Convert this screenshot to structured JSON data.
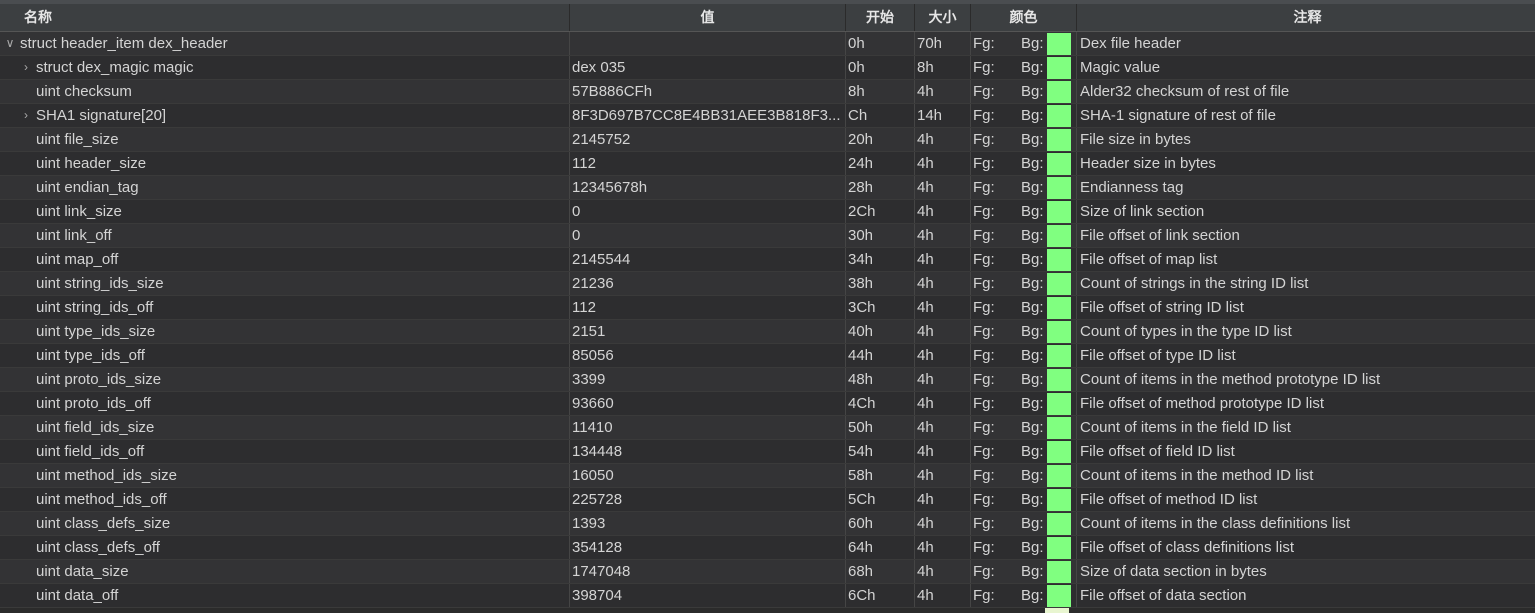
{
  "columns": {
    "name": "名称",
    "value": "值",
    "start": "开始",
    "size": "大小",
    "color": "颜色",
    "comment": "注释"
  },
  "color_labels": {
    "fg": "Fg:",
    "bg": "Bg:"
  },
  "colors": {
    "bg_swatch": "#80ff80",
    "header_bg": "#3c3f41",
    "row_bg": "#2d2d2f"
  },
  "rows": [
    {
      "name": "struct header_item dex_header",
      "value": "",
      "start": "0h",
      "size": "70h",
      "comment": "Dex file header",
      "level": 0,
      "expander": "expanded"
    },
    {
      "name": "struct dex_magic magic",
      "value": "dex 035",
      "start": "0h",
      "size": "8h",
      "comment": "Magic value",
      "level": 1,
      "expander": "collapsed"
    },
    {
      "name": "uint checksum",
      "value": "57B886CFh",
      "start": "8h",
      "size": "4h",
      "comment": "Alder32 checksum of rest of file",
      "level": 1,
      "expander": "none"
    },
    {
      "name": "SHA1 signature[20]",
      "value": "8F3D697B7CC8E4BB31AEE3B818F3...",
      "start": "Ch",
      "size": "14h",
      "comment": "SHA-1 signature of rest of file",
      "level": 1,
      "expander": "collapsed"
    },
    {
      "name": "uint file_size",
      "value": "2145752",
      "start": "20h",
      "size": "4h",
      "comment": "File size in bytes",
      "level": 1,
      "expander": "none"
    },
    {
      "name": "uint header_size",
      "value": "112",
      "start": "24h",
      "size": "4h",
      "comment": "Header size in bytes",
      "level": 1,
      "expander": "none"
    },
    {
      "name": "uint endian_tag",
      "value": "12345678h",
      "start": "28h",
      "size": "4h",
      "comment": "Endianness tag",
      "level": 1,
      "expander": "none"
    },
    {
      "name": "uint link_size",
      "value": "0",
      "start": "2Ch",
      "size": "4h",
      "comment": "Size of link section",
      "level": 1,
      "expander": "none"
    },
    {
      "name": "uint link_off",
      "value": "0",
      "start": "30h",
      "size": "4h",
      "comment": "File offset of link section",
      "level": 1,
      "expander": "none"
    },
    {
      "name": "uint map_off",
      "value": "2145544",
      "start": "34h",
      "size": "4h",
      "comment": "File offset of map list",
      "level": 1,
      "expander": "none"
    },
    {
      "name": "uint string_ids_size",
      "value": "21236",
      "start": "38h",
      "size": "4h",
      "comment": "Count of strings in the string ID list",
      "level": 1,
      "expander": "none"
    },
    {
      "name": "uint string_ids_off",
      "value": "112",
      "start": "3Ch",
      "size": "4h",
      "comment": "File offset of string ID list",
      "level": 1,
      "expander": "none"
    },
    {
      "name": "uint type_ids_size",
      "value": "2151",
      "start": "40h",
      "size": "4h",
      "comment": "Count of types in the type ID list",
      "level": 1,
      "expander": "none"
    },
    {
      "name": "uint type_ids_off",
      "value": "85056",
      "start": "44h",
      "size": "4h",
      "comment": "File offset of type ID list",
      "level": 1,
      "expander": "none"
    },
    {
      "name": "uint proto_ids_size",
      "value": "3399",
      "start": "48h",
      "size": "4h",
      "comment": "Count of items in the method prototype ID list",
      "level": 1,
      "expander": "none"
    },
    {
      "name": "uint proto_ids_off",
      "value": "93660",
      "start": "4Ch",
      "size": "4h",
      "comment": "File offset of method prototype ID list",
      "level": 1,
      "expander": "none"
    },
    {
      "name": "uint field_ids_size",
      "value": "11410",
      "start": "50h",
      "size": "4h",
      "comment": "Count of items in the field ID list",
      "level": 1,
      "expander": "none"
    },
    {
      "name": "uint field_ids_off",
      "value": "134448",
      "start": "54h",
      "size": "4h",
      "comment": "File offset of field ID list",
      "level": 1,
      "expander": "none"
    },
    {
      "name": "uint method_ids_size",
      "value": "16050",
      "start": "58h",
      "size": "4h",
      "comment": "Count of items in the method ID list",
      "level": 1,
      "expander": "none"
    },
    {
      "name": "uint method_ids_off",
      "value": "225728",
      "start": "5Ch",
      "size": "4h",
      "comment": "File offset of method ID list",
      "level": 1,
      "expander": "none"
    },
    {
      "name": "uint class_defs_size",
      "value": "1393",
      "start": "60h",
      "size": "4h",
      "comment": "Count of items in the class definitions list",
      "level": 1,
      "expander": "none"
    },
    {
      "name": "uint class_defs_off",
      "value": "354128",
      "start": "64h",
      "size": "4h",
      "comment": "File offset of class definitions list",
      "level": 1,
      "expander": "none"
    },
    {
      "name": "uint data_size",
      "value": "1747048",
      "start": "68h",
      "size": "4h",
      "comment": "Size of data section in bytes",
      "level": 1,
      "expander": "none"
    },
    {
      "name": "uint data_off",
      "value": "398704",
      "start": "6Ch",
      "size": "4h",
      "comment": "File offset of data section",
      "level": 1,
      "expander": "none"
    }
  ]
}
